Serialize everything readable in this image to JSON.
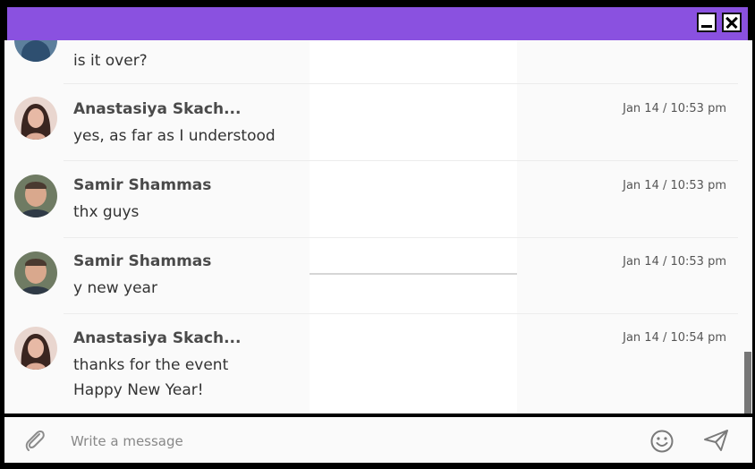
{
  "titlebar": {
    "color": "#8a51e0",
    "buttons": [
      "minimize-icon",
      "close-icon"
    ]
  },
  "messages": [
    {
      "name": "",
      "time": "",
      "lines": [
        "is it over?"
      ],
      "avatar": "user-avatar-partial"
    },
    {
      "name": "Anastasiya Skach...",
      "time": "Jan 14 / 10:53 pm",
      "lines": [
        "yes, as far as I understood"
      ],
      "avatar": "avatar-anastasiya"
    },
    {
      "name": "Samir Shammas",
      "time": "Jan 14 / 10:53 pm",
      "lines": [
        "thx guys"
      ],
      "avatar": "avatar-samir"
    },
    {
      "name": "Samir Shammas",
      "time": "Jan 14 / 10:53 pm",
      "lines": [
        "y new year"
      ],
      "avatar": "avatar-samir"
    },
    {
      "name": "Anastasiya Skach...",
      "time": "Jan 14 / 10:54 pm",
      "lines": [
        "thanks for the event",
        "Happy New Year!"
      ],
      "avatar": "avatar-anastasiya"
    }
  ],
  "composer": {
    "placeholder": "Write a message",
    "attach_icon": "paperclip-icon",
    "emoji_icon": "smiley-icon",
    "send_icon": "send-icon"
  }
}
